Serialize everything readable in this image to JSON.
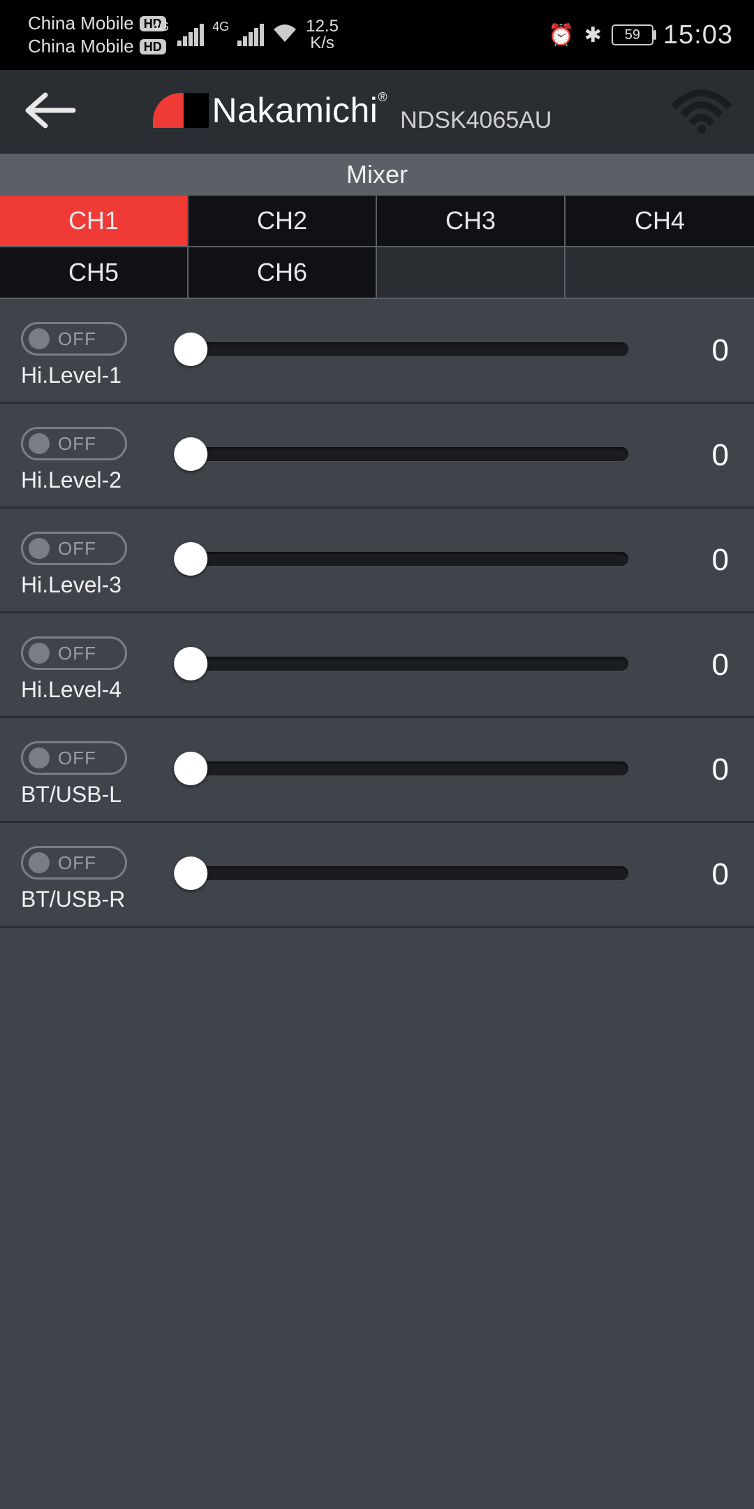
{
  "status": {
    "carrier1": "China Mobile",
    "carrier2": "China Mobile",
    "net_label": "4G",
    "speed_top": "12.5",
    "speed_bot": "K/s",
    "battery": "59",
    "time": "15:03"
  },
  "header": {
    "brand": "Nakamichi",
    "model": "NDSK4065AU"
  },
  "section_title": "Mixer",
  "tabs": [
    {
      "label": "CH1",
      "active": true
    },
    {
      "label": "CH2",
      "active": false
    },
    {
      "label": "CH3",
      "active": false
    },
    {
      "label": "CH4",
      "active": false
    },
    {
      "label": "CH5",
      "active": false
    },
    {
      "label": "CH6",
      "active": false
    }
  ],
  "rows": [
    {
      "toggle": "OFF",
      "label": "Hi.Level-1",
      "value": "0"
    },
    {
      "toggle": "OFF",
      "label": "Hi.Level-2",
      "value": "0"
    },
    {
      "toggle": "OFF",
      "label": "Hi.Level-3",
      "value": "0"
    },
    {
      "toggle": "OFF",
      "label": "Hi.Level-4",
      "value": "0"
    },
    {
      "toggle": "OFF",
      "label": "BT/USB-L",
      "value": "0"
    },
    {
      "toggle": "OFF",
      "label": "BT/USB-R",
      "value": "0"
    }
  ]
}
